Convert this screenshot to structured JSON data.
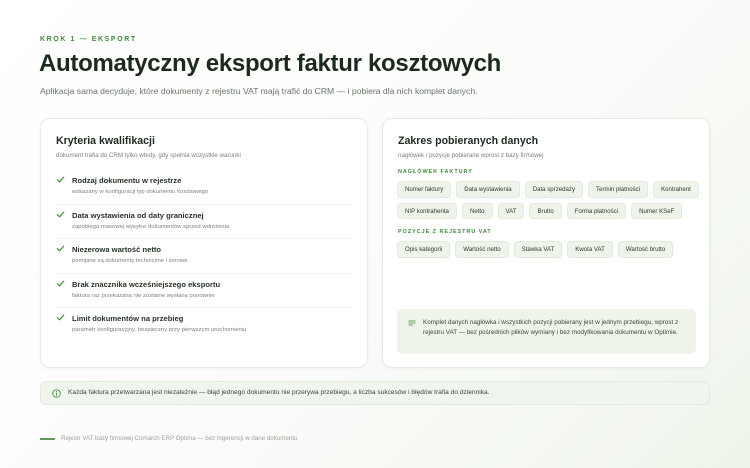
{
  "header": {
    "step": "KROK 1 — EKSPORT",
    "title": "Automatyczny eksport faktur kosztowych",
    "subtitle": "Aplikacja sama decyduje, które dokumenty z rejestru VAT mają trafić do CRM — i pobiera dla nich komplet danych."
  },
  "criteria_card": {
    "title": "Kryteria kwalifikacji",
    "subtitle": "dokument trafia do CRM tylko wtedy, gdy spełnia wszystkie warunki",
    "items": [
      {
        "label": "Rodzaj dokumentu w rejestrze",
        "desc": "wskazany w konfiguracji typ dokumentu kosztowego",
        "icon": "check-icon"
      },
      {
        "label": "Data wystawienia od daty granicznej",
        "desc": "zapobiega masowej wysyłce dokumentów sprzed wdrożenia",
        "icon": "check-icon"
      },
      {
        "label": "Niezerowa wartość netto",
        "desc": "pomijane są dokumenty techniczne i zerowe",
        "icon": "check-icon"
      },
      {
        "label": "Brak znacznika wcześniejszego eksportu",
        "desc": "faktura raz przekazana nie zostanie wysłana ponownie",
        "icon": "check-icon"
      },
      {
        "label": "Limit dokumentów na przebieg",
        "desc": "parametr konfiguracyjny, bezpieczny przy pierwszym uruchomieniu",
        "icon": "check-icon"
      }
    ]
  },
  "data_card": {
    "title": "Zakres pobieranych danych",
    "subtitle": "nagłówek i pozycje pobierane wprost z bazy firmowej",
    "header_section_label": "NAGŁÓWEK FAKTURY",
    "header_fields": [
      "Numer faktury",
      "Data wystawienia",
      "Data sprzedaży",
      "Termin płatności",
      "Kontrahent",
      "NIP kontrahenta",
      "Netto",
      "VAT",
      "Brutto",
      "Forma płatności",
      "Numer KSeF"
    ],
    "items_section_label": "POZYCJE Z REJESTRU VAT",
    "item_fields": [
      "Opis kategorii",
      "Wartość netto",
      "Stawka VAT",
      "Kwota VAT",
      "Wartość brutto"
    ],
    "note": "Komplet danych nagłówka i wszystkich pozycji pobierany jest w jednym przebiegu, wprost z rejestru VAT — bez pośrednich plików wymiany i bez modyfikowania dokumentu w Optimie.",
    "note_icon": "text-lines-icon"
  },
  "banner": {
    "icon": "info-icon",
    "text": "Każda faktura przetwarzana jest niezależnie — błąd jednego dokumentu nie przerywa przebiegu, a liczba sukcesów i błędów trafia do dziennika."
  },
  "footer": {
    "text": "Rejestr VAT bazy firmowej Comarch ERP Optima — bez ingerencji w dane dokumentu"
  },
  "colors": {
    "accent": "#3f8a3a",
    "chip_bg": "#eef4ea",
    "text_dark": "#1f2a1f"
  }
}
